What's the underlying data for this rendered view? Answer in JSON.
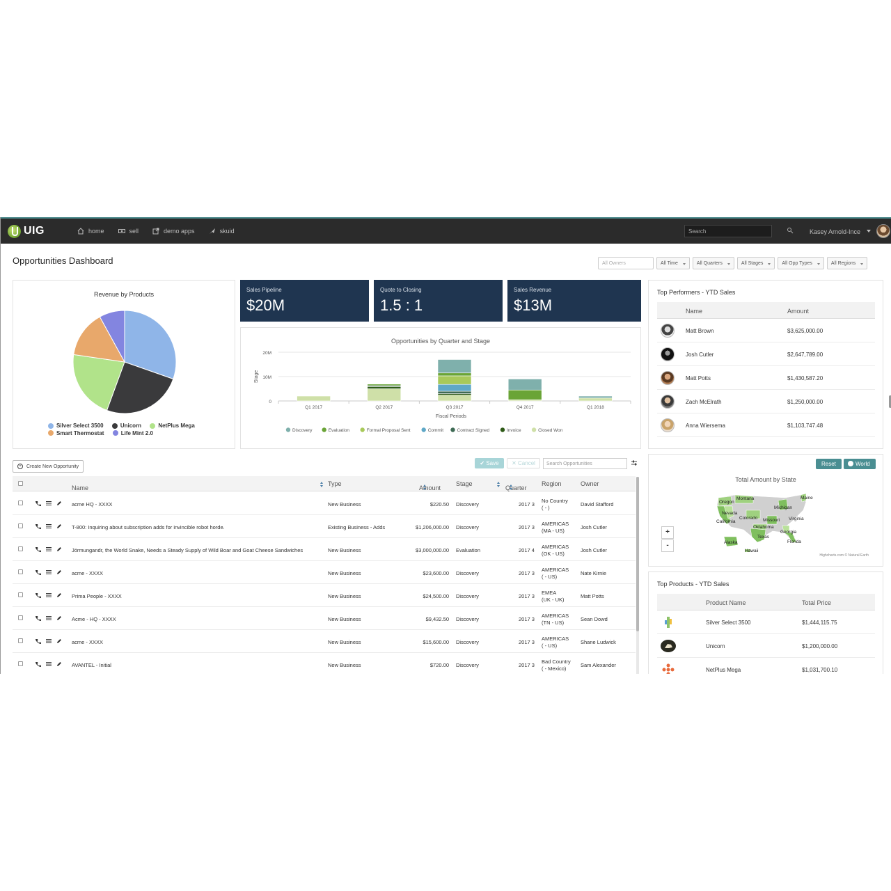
{
  "nav": {
    "logo": "UIG",
    "items": [
      {
        "label": "home",
        "icon": "home-icon"
      },
      {
        "label": "sell",
        "icon": "money-icon"
      },
      {
        "label": "demo apps",
        "icon": "external-link-icon"
      },
      {
        "label": "skuid",
        "icon": "rocket-icon"
      }
    ],
    "search_placeholder": "Search",
    "user": "Kasey Arnold-Ince"
  },
  "page": {
    "title": "Opportunities Dashboard",
    "filters": {
      "owners_placeholder": "All Owners",
      "time": "All Time",
      "quarters": "All Quarters",
      "stages": "All Stages",
      "opp_types": "All Opp Types",
      "regions": "All Regions"
    }
  },
  "pie": {
    "title": "Revenue by Products",
    "legend": [
      "Silver Select 3500",
      "Unicorn",
      "NetPlus Mega",
      "Smart Thermostat",
      "Life Mint 2.0"
    ]
  },
  "kpis": [
    {
      "label": "Sales Pipeline",
      "value": "$20M"
    },
    {
      "label": "Quote to Closing",
      "value": "1.5 : 1"
    },
    {
      "label": "Sales Revenue",
      "value": "$13M"
    }
  ],
  "bar_panel": {
    "title": "Opportunities by Quarter and Stage"
  },
  "chart_data": [
    {
      "type": "pie",
      "title": "Revenue by Products",
      "categories": [
        "Silver Select 3500",
        "Unicorn",
        "NetPlus Mega",
        "Smart Thermostat",
        "Life Mint 2.0"
      ],
      "values": [
        1444115.75,
        1200000.0,
        1031700.1,
        700000,
        380000
      ],
      "colors": [
        "#8fb5e8",
        "#3a3a3c",
        "#b1e38a",
        "#e8a86b",
        "#8385e0"
      ]
    },
    {
      "type": "bar",
      "stacked": true,
      "title": "Opportunities by Quarter and Stage",
      "xlabel": "Fiscal Periods",
      "ylabel": "Stage",
      "categories": [
        "Q1 2017",
        "Q2 2017",
        "Q3 2017",
        "Q4 2017",
        "Q1 2018"
      ],
      "ytick_labels": [
        "0",
        "10M",
        "20M"
      ],
      "ylim": [
        0,
        22000000
      ],
      "series": [
        {
          "name": "Discovery",
          "color": "#7fb0ac",
          "values": [
            0,
            0,
            5500000,
            4500000,
            800000
          ]
        },
        {
          "name": "Evaluation",
          "color": "#6aa437",
          "values": [
            0,
            600000,
            1200000,
            4000000,
            0
          ]
        },
        {
          "name": "Formal Proposal Sent",
          "color": "#a8c95a",
          "values": [
            0,
            0,
            3500000,
            0,
            0
          ]
        },
        {
          "name": "Commit",
          "color": "#5fa8c7",
          "values": [
            0,
            0,
            2800000,
            0,
            0
          ]
        },
        {
          "name": "Contract Signed",
          "color": "#3f6b55",
          "values": [
            0,
            400000,
            1000000,
            0,
            0
          ]
        },
        {
          "name": "Invoice",
          "color": "#2e5a17",
          "values": [
            0,
            900000,
            600000,
            0,
            0
          ]
        },
        {
          "name": "Closed Won",
          "color": "#cfe0a8",
          "values": [
            2000000,
            5000000,
            2400000,
            500000,
            1200000
          ]
        }
      ]
    }
  ],
  "performers": {
    "title": "Top Performers - YTD Sales",
    "col_name": "Name",
    "col_amount": "Amount",
    "rows": [
      {
        "name": "Matt Brown",
        "amount": "$3,625,000.00"
      },
      {
        "name": "Josh Cutler",
        "amount": "$2,647,789.00"
      },
      {
        "name": "Matt Potts",
        "amount": "$1,430,587.20"
      },
      {
        "name": "Zach McElrath",
        "amount": "$1,250,000.00"
      },
      {
        "name": "Anna Wiersema",
        "amount": "$1,103,747.48"
      }
    ]
  },
  "map": {
    "title": "Total Amount by State",
    "reset": "Reset",
    "world": "World",
    "zoom_in": "+",
    "zoom_out": "-",
    "credit": "Highcharts.com © Natural Earth",
    "labels": [
      "Montana",
      "Oregon",
      "Nevada",
      "California",
      "Colorado",
      "Michigan",
      "Maine",
      "Missouri",
      "Virginia",
      "Oklahoma",
      "Texas",
      "Georgia",
      "Florida",
      "Alaska",
      "Hawaii"
    ]
  },
  "products": {
    "title": "Top Products - YTD Sales",
    "col_name": "Product Name",
    "col_price": "Total Price",
    "rows": [
      {
        "name": "Silver Select 3500",
        "price": "$1,444,115.75"
      },
      {
        "name": "Unicorn",
        "price": "$1,200,000.00"
      },
      {
        "name": "NetPlus Mega",
        "price": "$1,031,700.10"
      }
    ]
  },
  "opps": {
    "create_label": "Create New Opportunity",
    "save": "Save",
    "cancel": "Cancel",
    "search_placeholder": "Search Opportunities",
    "columns": {
      "name": "Name",
      "type": "Type",
      "amount": "Amount",
      "stage": "Stage",
      "quarter": "Quarter",
      "region": "Region",
      "owner": "Owner"
    },
    "rows": [
      {
        "name": "acme HQ - XXXX",
        "type": "New Business",
        "amount": "$220.50",
        "stage": "Discovery",
        "quarter": "2017 3",
        "region1": "No Country",
        "region2": "( - )",
        "owner": "David Stafford"
      },
      {
        "name": "T-800: Inquiring about subscription adds for invincible robot horde.",
        "type": "Existing Business - Adds",
        "amount": "$1,206,000.00",
        "stage": "Discovery",
        "quarter": "2017 3",
        "region1": "AMERICAS",
        "region2": "(MA - US)",
        "owner": "Josh Cutler"
      },
      {
        "name": "Jörmungandr, the World Snake, Needs a Steady Supply of Wild Boar and Goat Cheese Sandwiches",
        "type": "New Business",
        "amount": "$3,000,000.00",
        "stage": "Evaluation",
        "quarter": "2017 4",
        "region1": "AMERICAS",
        "region2": "(OK - US)",
        "owner": "Josh Cutler"
      },
      {
        "name": "acme - XXXX",
        "type": "New Business",
        "amount": "$23,600.00",
        "stage": "Discovery",
        "quarter": "2017 3",
        "region1": "AMERICAS",
        "region2": "( - US)",
        "owner": "Nate Kirnie"
      },
      {
        "name": "Prima People - XXXX",
        "type": "New Business",
        "amount": "$24,500.00",
        "stage": "Discovery",
        "quarter": "2017 3",
        "region1": "EMEA",
        "region2": "(UK - UK)",
        "owner": "Matt Potts"
      },
      {
        "name": "Acme - HQ - XXXX",
        "type": "New Business",
        "amount": "$9,432.50",
        "stage": "Discovery",
        "quarter": "2017 3",
        "region1": "AMERICAS",
        "region2": "(TN - US)",
        "owner": "Sean Dowd"
      },
      {
        "name": "acme - XXXX",
        "type": "New Business",
        "amount": "$15,600.00",
        "stage": "Discovery",
        "quarter": "2017 3",
        "region1": "AMERICAS",
        "region2": "( - US)",
        "owner": "Shane Ludwick"
      },
      {
        "name": "AVANTEL - Initial",
        "type": "New Business",
        "amount": "$720.00",
        "stage": "Discovery",
        "quarter": "2017 3",
        "region1": "Bad Country",
        "region2": "( - Mexico)",
        "owner": "Sam Alexander"
      }
    ]
  }
}
